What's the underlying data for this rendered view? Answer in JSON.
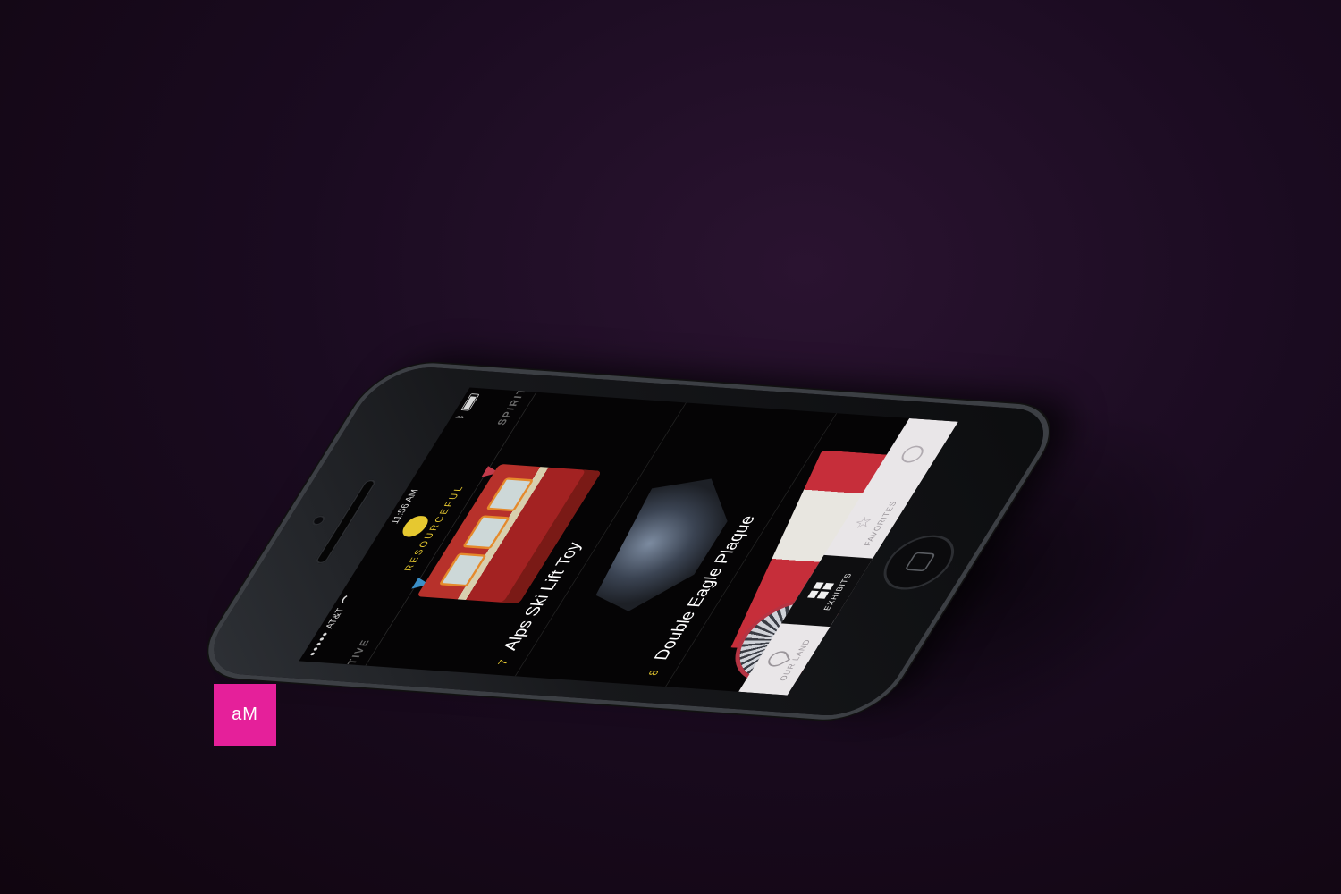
{
  "status_bar": {
    "carrier": "AT&T",
    "signal": "●●●●●",
    "time": "11:56 AM",
    "bluetooth_icon": "bluetooth-icon",
    "battery_icon": "battery-icon",
    "wifi_icon": "wifi-icon"
  },
  "categories": {
    "left": "VATIVE",
    "current": "RESOURCEFUL",
    "right": "SPIRITE",
    "current_color": "#e6c830",
    "emblem_icon": "bird-icon"
  },
  "exhibits": [
    {
      "number": "7",
      "title": "Alps Ski Lift Toy"
    },
    {
      "number": "8",
      "title": "Double Eagle Plaque"
    }
  ],
  "tabs": [
    {
      "label": "OUR LAND",
      "icon": "map-pin-icon",
      "active": false
    },
    {
      "label": "EXHIBITS",
      "icon": "grid-icon",
      "active": true
    },
    {
      "label": "FAVORITES",
      "icon": "star-icon",
      "active": false
    },
    {
      "label": "",
      "icon": "profile-icon",
      "active": false
    }
  ],
  "logo": {
    "text": "aM",
    "color": "#e5209a"
  },
  "colors": {
    "accent_yellow": "#e6c830",
    "background": "#1a0b20"
  }
}
